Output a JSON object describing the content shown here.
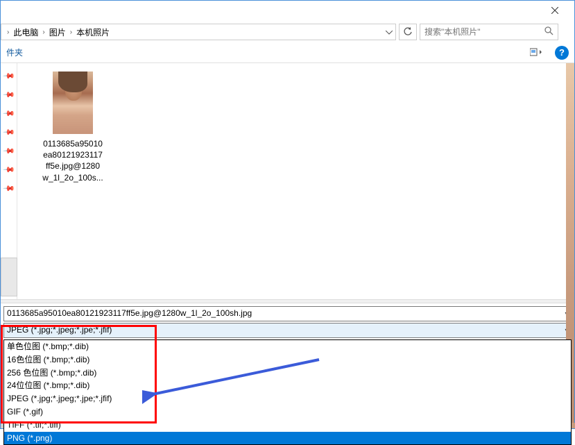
{
  "titlebar": {
    "close": "×"
  },
  "breadcrumb": {
    "items": [
      "此电脑",
      "图片",
      "本机照片"
    ]
  },
  "search": {
    "placeholder": "搜索\"本机照片\""
  },
  "toolbar": {
    "folder_label": "件夹",
    "help_glyph": "?"
  },
  "file": {
    "name_lines": [
      "0113685a95010",
      "ea80121923117",
      "ff5e.jpg@1280",
      "w_1l_2o_100s..."
    ]
  },
  "filename": {
    "value": "0113685a95010ea80121923117ff5e.jpg@1280w_1l_2o_100sh.jpg"
  },
  "filetype": {
    "selected": "JPEG (*.jpg;*.jpeg;*.jpe;*.jfif)",
    "options": [
      "单色位图 (*.bmp;*.dib)",
      "16色位图 (*.bmp;*.dib)",
      "256 色位图 (*.bmp;*.dib)",
      "24位位图 (*.bmp;*.dib)",
      "JPEG (*.jpg;*.jpeg;*.jpe;*.jfif)",
      "GIF (*.gif)",
      "TIFF (*.tif;*.tiff)",
      "PNG (*.png)"
    ],
    "highlighted_index": 7
  }
}
